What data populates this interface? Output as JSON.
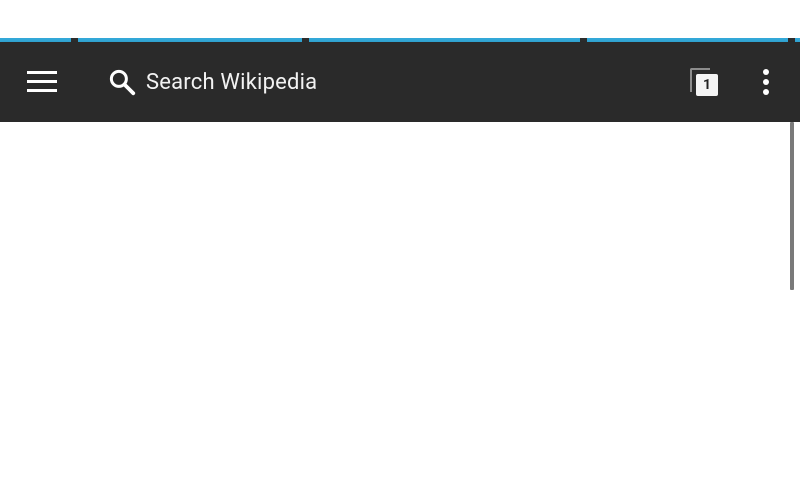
{
  "toolbar": {
    "search_placeholder": "Search Wikipedia",
    "tab_count": "1"
  },
  "icons": {
    "menu": "hamburger-menu-icon",
    "search": "search-icon",
    "tabs": "tabs-icon",
    "more": "more-vert-icon"
  },
  "colors": {
    "toolbar_bg": "#2a2a2a",
    "progress_accent": "#33a8d8",
    "text_primary": "#f2f2f2"
  }
}
